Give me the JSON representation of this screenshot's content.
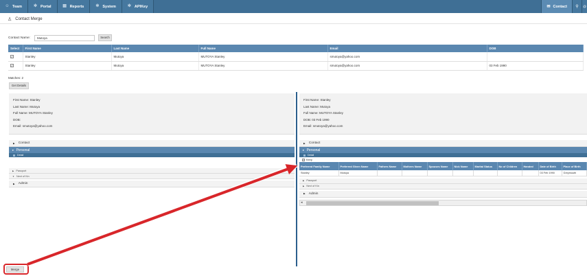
{
  "nav": {
    "items": [
      {
        "label": "Team",
        "icon": "team-icon",
        "glyph": "☺"
      },
      {
        "label": "Portal",
        "icon": "portal-icon",
        "glyph": "✲"
      },
      {
        "label": "Reports",
        "icon": "reports-icon",
        "glyph": "▤"
      },
      {
        "label": "System",
        "icon": "system-icon",
        "glyph": "✲"
      },
      {
        "label": "APIKey",
        "icon": "apikey-icon",
        "glyph": "✲"
      }
    ],
    "contact_label": "Contact",
    "contact_glyph": "✉",
    "search_glyph": "⚲",
    "more_glyph": "@"
  },
  "page": {
    "title": "Contact Merge",
    "title_glyph": "♙"
  },
  "search": {
    "label": "Contact Name:",
    "value": "Mutoya",
    "button": "Search"
  },
  "results": {
    "headers": [
      "Select",
      "First Name",
      "Last Name",
      "Full Name",
      "Email",
      "DOB"
    ],
    "rows": [
      {
        "select": "✓",
        "first": "Stanley",
        "last": "Mutoya",
        "full": "MUTOYA Stanley",
        "email": "smutoya@yahoo.com",
        "dob": ""
      },
      {
        "select": "✓",
        "first": "Stanley",
        "last": "Mutoya",
        "full": "MUTOYA Stanley",
        "email": "smutoya@yahoo.com",
        "dob": "03 Feb 1990"
      }
    ]
  },
  "matches": "Matches: 2",
  "get_details": "Get Details",
  "left": {
    "summary": [
      "First Name: Stanley",
      "Last Name: Mutoya",
      "Full Name:  MUTOYA Stanley",
      "DOB:",
      "Email:       smutoya@yahoo.com"
    ],
    "contact": "Contact",
    "personal": "Personal",
    "detail": "Detail",
    "passport": "Passport",
    "next_of_kin": "Next of Kin",
    "admin": "Admin"
  },
  "right": {
    "summary": [
      "First Name: Stanley",
      "Last Name: Mutoya",
      "Full Name:  MUTOYA Stanley",
      "DOB:          03 Feb 1990",
      "Email:       smutoya@yahoo.com"
    ],
    "contact": "Contact",
    "personal": "Personal",
    "detail": "Detail",
    "keep": "Keep",
    "table_headers": [
      "Preferred Family Name",
      "Preferred Given Name",
      "Fathers Name",
      "Mothers Name",
      "Spouses Name",
      "Nick Name",
      "Marital Status",
      "No of Children",
      "Handed",
      "Date of Birth",
      "Place of Birth"
    ],
    "table_row": [
      "Stanley",
      "Mutoya",
      "",
      "",
      "",
      "",
      "",
      "",
      "",
      "03 Feb 1990",
      "Greymouth"
    ],
    "passport": "Passport",
    "next_of_kin": "Next of Kin",
    "admin": "Admin",
    "scroll_left_glyph": "◂"
  },
  "merge": "Merge",
  "colors": {
    "nav_bg": "#3f6f95",
    "header_blue": "#5a87b0",
    "annotation_red": "#d8262a"
  }
}
